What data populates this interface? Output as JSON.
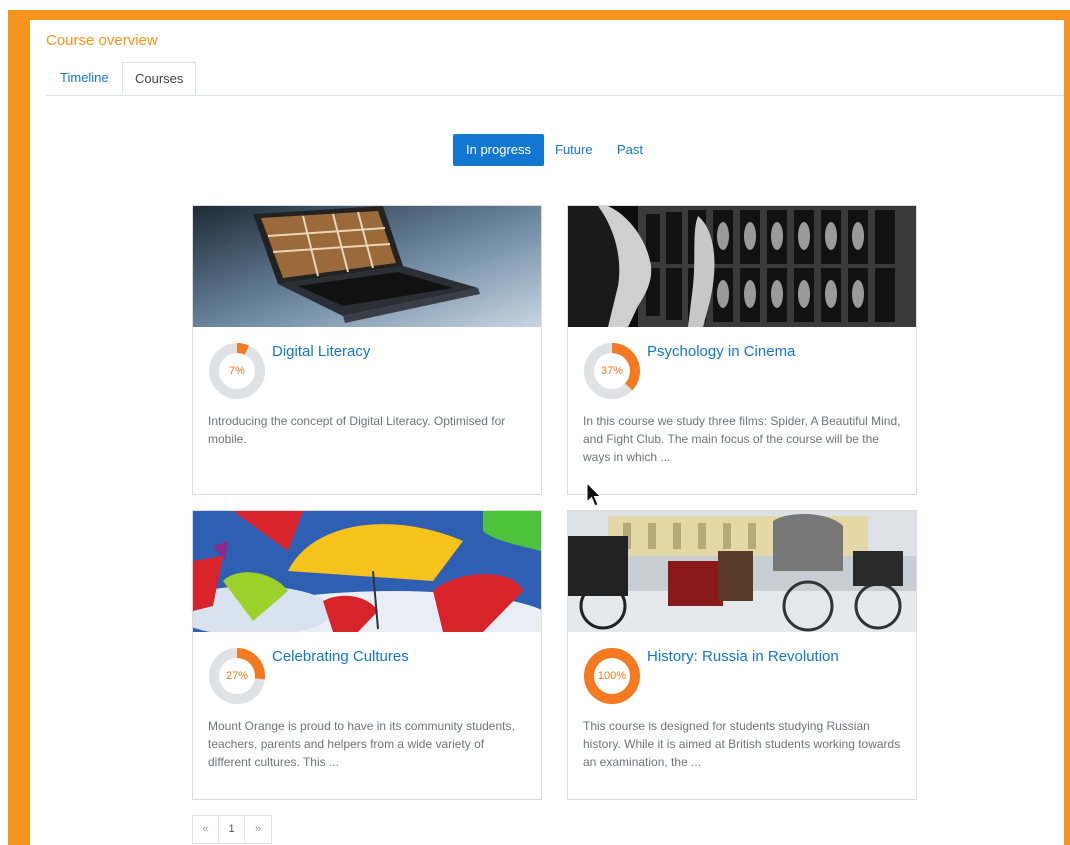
{
  "block": {
    "title": "Course overview"
  },
  "tabs": [
    {
      "label": "Timeline"
    },
    {
      "label": "Courses"
    }
  ],
  "filters": [
    {
      "label": "In progress"
    },
    {
      "label": "Future"
    },
    {
      "label": "Past"
    }
  ],
  "courses": [
    {
      "name": "Digital Literacy",
      "progress_label": "7%",
      "progress": 0.07,
      "summary": "Introducing the concept of Digital Literacy. Optimised for mobile."
    },
    {
      "name": "Psychology in Cinema",
      "progress_label": "37%",
      "progress": 0.37,
      "summary": "In this course we study three films: Spider, A Beautiful Mind, and Fight Club. The main focus of the course will be the ways in which ..."
    },
    {
      "name": "Celebrating Cultures",
      "progress_label": "27%",
      "progress": 0.27,
      "summary": "Mount Orange is proud to have in its community students, teachers, parents and helpers from a wide variety of different cultures. This ..."
    },
    {
      "name": "History: Russia in Revolution",
      "progress_label": "100%",
      "progress": 1.0,
      "summary": "This course is designed for students studying Russian history. While it is aimed at British students working towards an examination, the ..."
    }
  ],
  "pagination": {
    "prev": "«",
    "page": "1",
    "next": "»"
  },
  "colors": {
    "accent": "#f7941d",
    "link": "#1177d1",
    "progress": "#f47920",
    "track": "#dfe2e5"
  }
}
